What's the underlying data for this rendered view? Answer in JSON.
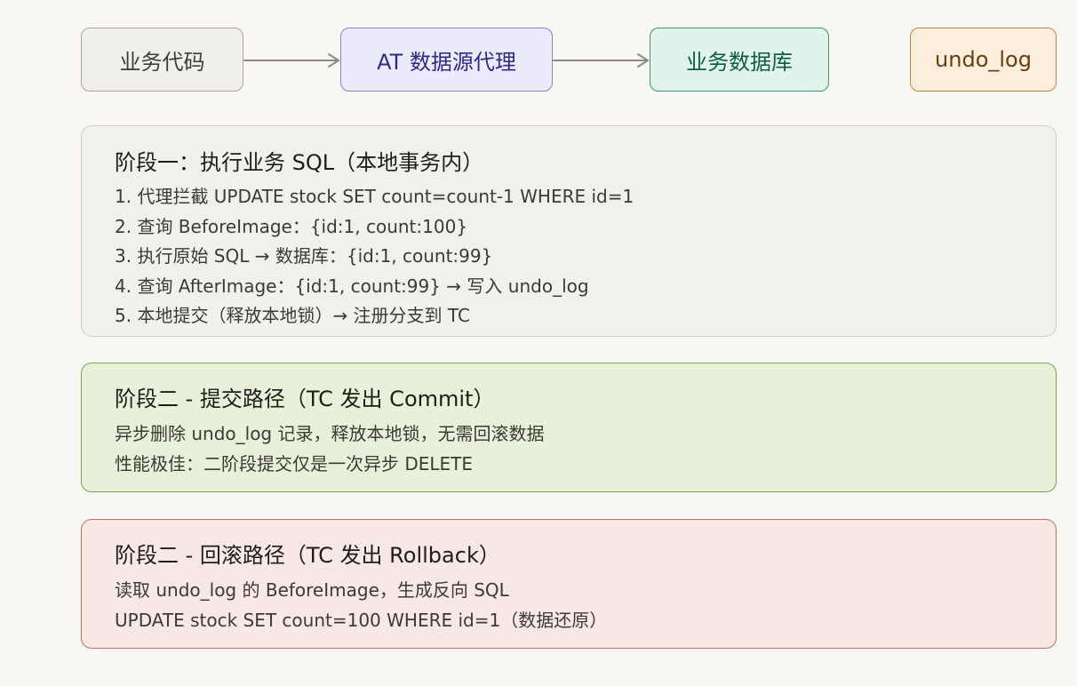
{
  "nodes": {
    "business_code": "业务代码",
    "at_proxy": "AT 数据源代理",
    "business_db": "业务数据库",
    "undo_log": "undo_log"
  },
  "phase1": {
    "title": "阶段一：执行业务 SQL（本地事务内）",
    "steps": [
      "1. 代理拦截 UPDATE stock SET count=count-1 WHERE id=1",
      "2. 查询 BeforeImage：{id:1, count:100}",
      "3. 执行原始 SQL → 数据库：{id:1, count:99}",
      "4. 查询 AfterImage：{id:1, count:99} → 写入 undo_log",
      "5. 本地提交（释放本地锁）→ 注册分支到 TC"
    ]
  },
  "phase2_commit": {
    "title": "阶段二 - 提交路径（TC 发出 Commit）",
    "lines": [
      "异步删除 undo_log 记录，释放本地锁，无需回滚数据",
      "性能极佳：二阶段提交仅是一次异步 DELETE"
    ]
  },
  "phase2_rollback": {
    "title": "阶段二 - 回滚路径（TC 发出 Rollback）",
    "lines": [
      "读取 undo_log 的 BeforeImage，生成反向 SQL",
      "UPDATE stock SET count=100 WHERE id=1（数据还原）"
    ]
  },
  "colors": {
    "background": "#f9f7f3",
    "arrow": "#8e8b84",
    "proxy_accent": "#8880d6",
    "db_accent": "#3f9477",
    "undo_accent": "#b88838",
    "commit_accent": "#78a44e",
    "rollback_accent": "#c46a62"
  }
}
